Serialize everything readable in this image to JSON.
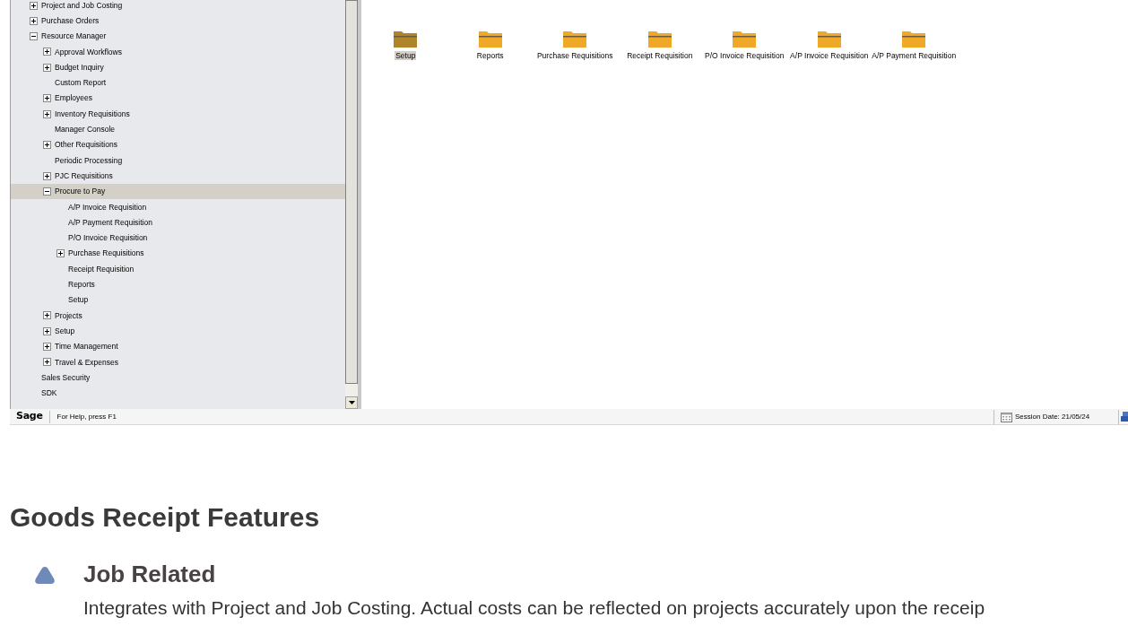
{
  "tree": [
    {
      "label": "Project and Job Costing",
      "kind": "node",
      "expanded": false,
      "selected": false
    },
    {
      "label": "Purchase Orders",
      "kind": "node",
      "expanded": false,
      "selected": false
    },
    {
      "label": "Resource Manager",
      "kind": "node",
      "expanded": true,
      "selected": false,
      "children": [
        {
          "label": "Approval Workflows",
          "kind": "node",
          "expanded": false,
          "selected": false
        },
        {
          "label": "Budget Inquiry",
          "kind": "node",
          "expanded": false,
          "selected": false
        },
        {
          "label": "Custom Report",
          "kind": "leaf",
          "selected": false
        },
        {
          "label": "Employees",
          "kind": "node",
          "expanded": false,
          "selected": false
        },
        {
          "label": "Inventory Requisitions",
          "kind": "node",
          "expanded": false,
          "selected": false
        },
        {
          "label": "Manager Console",
          "kind": "leaf",
          "selected": false
        },
        {
          "label": "Other Requisitions",
          "kind": "node",
          "expanded": false,
          "selected": false
        },
        {
          "label": "Periodic Processing",
          "kind": "leaf",
          "selected": false
        },
        {
          "label": "PJC Requisitions",
          "kind": "node",
          "expanded": false,
          "selected": false
        },
        {
          "label": "Procure to Pay",
          "kind": "node",
          "expanded": true,
          "selected": true,
          "children": [
            {
              "label": "A/P Invoice Requisition",
              "kind": "leaf",
              "selected": false
            },
            {
              "label": "A/P Payment Requisition",
              "kind": "leaf",
              "selected": false
            },
            {
              "label": "P/O Invoice Requisition",
              "kind": "leaf",
              "selected": false
            },
            {
              "label": "Purchase Requisitions",
              "kind": "node",
              "expanded": false,
              "selected": false
            },
            {
              "label": "Receipt Requisition",
              "kind": "leaf",
              "selected": false
            },
            {
              "label": "Reports",
              "kind": "leaf",
              "selected": false
            },
            {
              "label": "Setup",
              "kind": "leaf",
              "selected": false
            }
          ]
        },
        {
          "label": "Projects",
          "kind": "node",
          "expanded": false,
          "selected": false
        },
        {
          "label": "Setup",
          "kind": "node",
          "expanded": false,
          "selected": false
        },
        {
          "label": "Time Management",
          "kind": "node",
          "expanded": false,
          "selected": false
        },
        {
          "label": "Travel & Expenses",
          "kind": "node",
          "expanded": false,
          "selected": false
        }
      ]
    },
    {
      "label": "Sales Security",
      "kind": "leaf",
      "selected": false
    },
    {
      "label": "SDK",
      "kind": "leaf",
      "selected": false
    }
  ],
  "folders": [
    {
      "label": "Setup",
      "selected": true
    },
    {
      "label": "Reports",
      "selected": false
    },
    {
      "label": "Purchase Requisitions",
      "selected": false
    },
    {
      "label": "Receipt Requisition",
      "selected": false
    },
    {
      "label": "P/O Invoice Requisition",
      "selected": false
    },
    {
      "label": "A/P Invoice Requisition",
      "selected": false
    },
    {
      "label": "A/P Payment Requisition",
      "selected": false
    }
  ],
  "status_bar": {
    "logo": "Sage",
    "help": "For Help, press F1",
    "session_date": "Session Date: 21/05/24"
  },
  "article": {
    "heading": "Goods Receipt Features",
    "features": [
      {
        "title": "Job Related",
        "text": "Integrates with Project and Job Costing. Actual costs can be reflected on projects accurately upon the receip"
      }
    ]
  }
}
